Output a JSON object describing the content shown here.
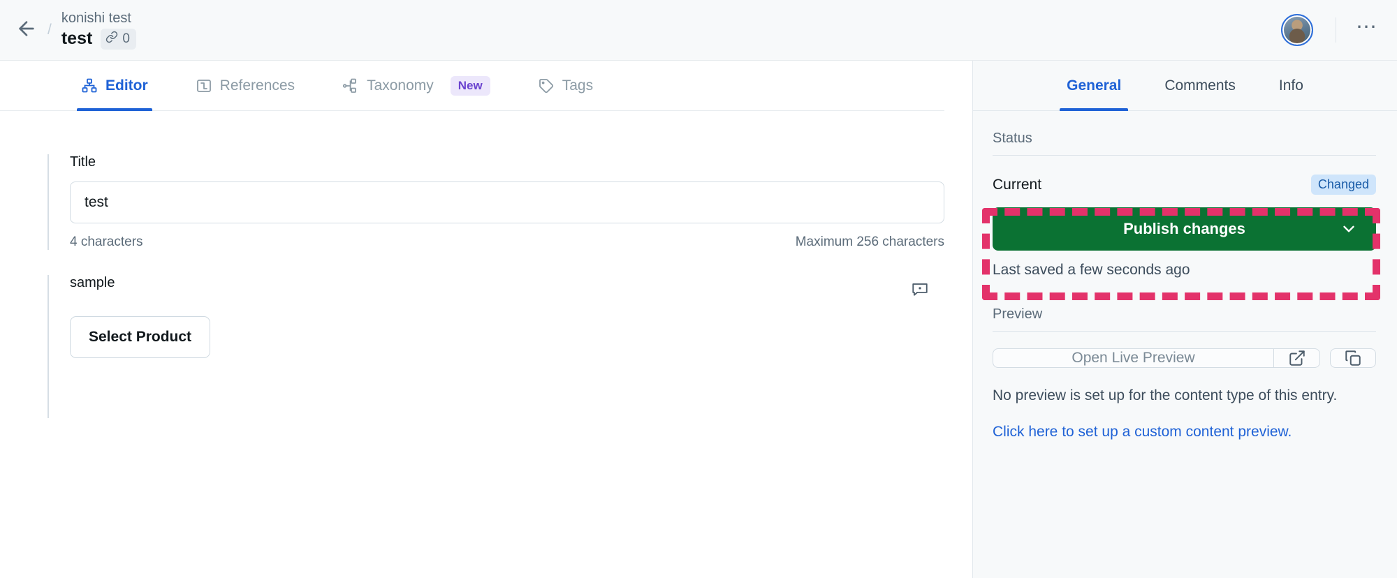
{
  "header": {
    "back_icon": "arrow-left-icon",
    "breadcrumb_separator": "/",
    "breadcrumb_parent": "konishi test",
    "entry_title": "test",
    "link_icon": "link-icon",
    "link_count": "0",
    "avatar": "user-avatar",
    "more_label": "⋯"
  },
  "main_tabs": [
    {
      "label": "Editor",
      "icon": "content-model-icon",
      "active": true,
      "badge": ""
    },
    {
      "label": "References",
      "icon": "references-icon",
      "active": false,
      "badge": ""
    },
    {
      "label": "Taxonomy",
      "icon": "taxonomy-icon",
      "active": false,
      "badge": "New"
    },
    {
      "label": "Tags",
      "icon": "tag-icon",
      "active": false,
      "badge": ""
    }
  ],
  "editor": {
    "title_field": {
      "label": "Title",
      "value": "test",
      "placeholder": "",
      "char_count": "4 characters",
      "max_note": "Maximum 256 characters"
    },
    "sample_field": {
      "label": "sample",
      "comment_icon": "comment-icon",
      "button_label": "Select Product"
    }
  },
  "sidebar": {
    "tabs": [
      {
        "label": "General",
        "active": true
      },
      {
        "label": "Comments",
        "active": false
      },
      {
        "label": "Info",
        "active": false
      }
    ],
    "status": {
      "section_label": "Status",
      "current_label": "Current",
      "status_chip": "Changed",
      "publish_label": "Publish changes",
      "publish_caret_icon": "chevron-down-icon",
      "publish_color": "#0b7233",
      "last_saved": "Last saved a few seconds ago"
    },
    "preview": {
      "section_label": "Preview",
      "open_label": "Open Live Preview",
      "external_icon": "external-link-icon",
      "copy_icon": "copy-icon",
      "note": "No preview is set up for the content type of this entry.",
      "link_text": "Click here to set up a custom content preview."
    }
  },
  "annotation": {
    "name": "publish-highlight-box",
    "color": "#e3326a",
    "style": "dashed"
  }
}
